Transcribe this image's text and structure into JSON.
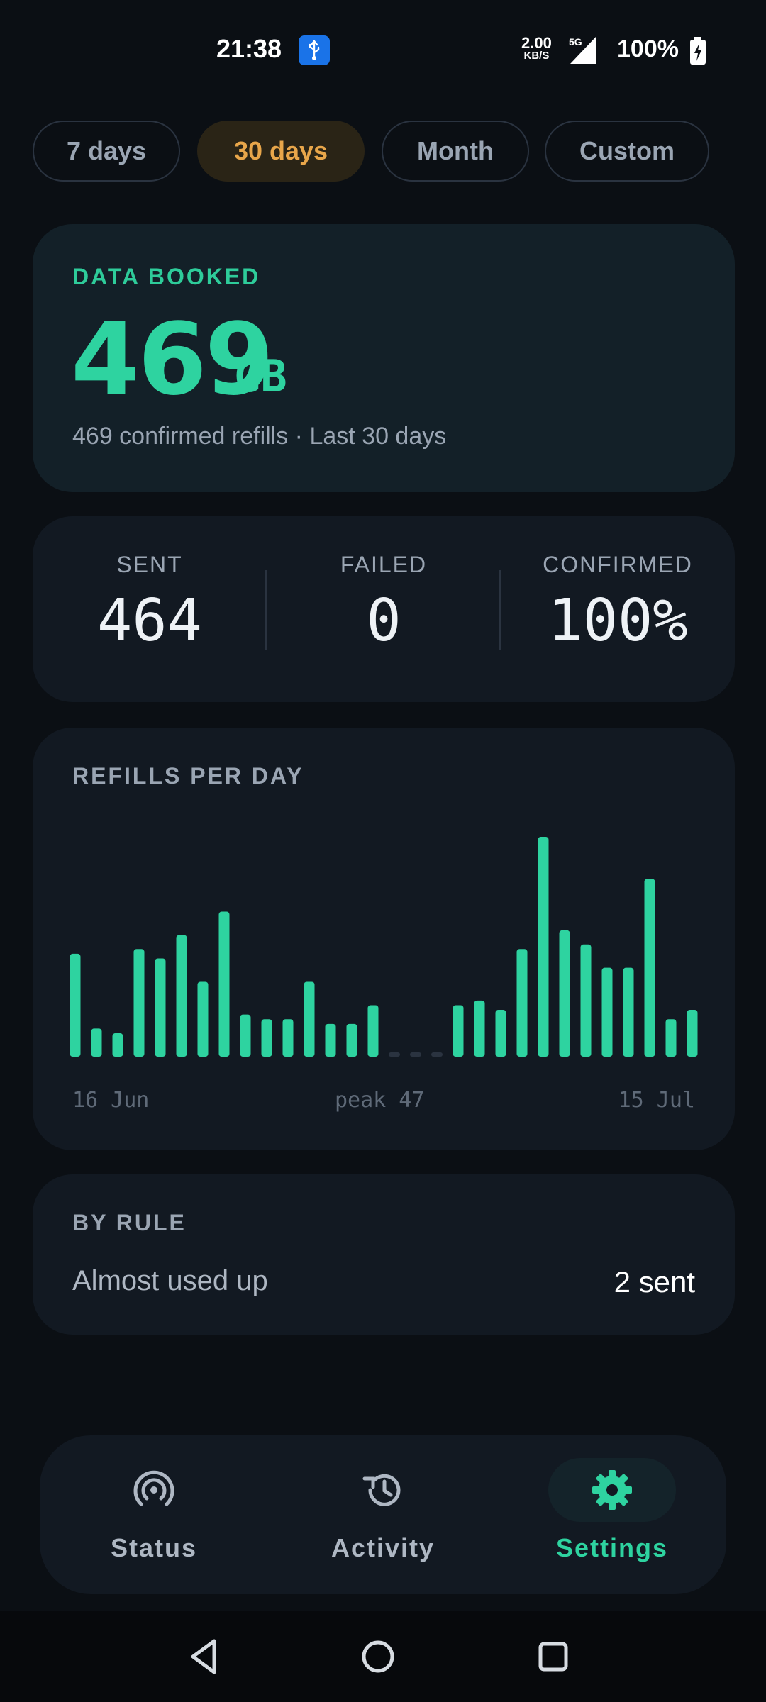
{
  "status_bar": {
    "time": "21:38",
    "usb_icon": "usb-icon",
    "speed_value": "2.00",
    "speed_unit": "KB/S",
    "network": "5G",
    "battery": "100%"
  },
  "range": {
    "options": [
      "7 days",
      "30 days",
      "Month",
      "Custom"
    ],
    "selected": "30 days"
  },
  "booked": {
    "label": "DATA BOOKED",
    "value": "469",
    "unit": "GB",
    "subtitle": "469 confirmed refills · Last 30 days"
  },
  "stats": {
    "sent_label": "SENT",
    "sent_value": "464",
    "failed_label": "FAILED",
    "failed_value": "0",
    "confirmed_label": "CONFIRMED",
    "confirmed_value": "100%"
  },
  "chart_data": {
    "type": "bar",
    "title": "REFILLS PER DAY",
    "x_start_label": "16 Jun",
    "x_end_label": "15 Jul",
    "peak_label": "peak 47",
    "ylim": [
      0,
      47
    ],
    "values": [
      22,
      6,
      5,
      23,
      21,
      26,
      16,
      31,
      9,
      8,
      8,
      16,
      7,
      7,
      11,
      0,
      0,
      0,
      11,
      12,
      10,
      23,
      47,
      27,
      24,
      19,
      19,
      38,
      8,
      10
    ],
    "colors": {
      "bar": "#2ed3a0",
      "empty": "#2a3340"
    }
  },
  "by_rule": {
    "label": "BY RULE",
    "rows": [
      {
        "name": "Almost used up",
        "count": "2 sent"
      }
    ]
  },
  "nav": {
    "items": [
      {
        "label": "Status",
        "icon": "broadcast-icon"
      },
      {
        "label": "Activity",
        "icon": "history-icon"
      },
      {
        "label": "Settings",
        "icon": "gear-icon"
      }
    ],
    "active": "Settings"
  },
  "colors": {
    "accent": "#2ed3a0",
    "chip_active": "#e8a64a",
    "background": "#0b0f14"
  }
}
